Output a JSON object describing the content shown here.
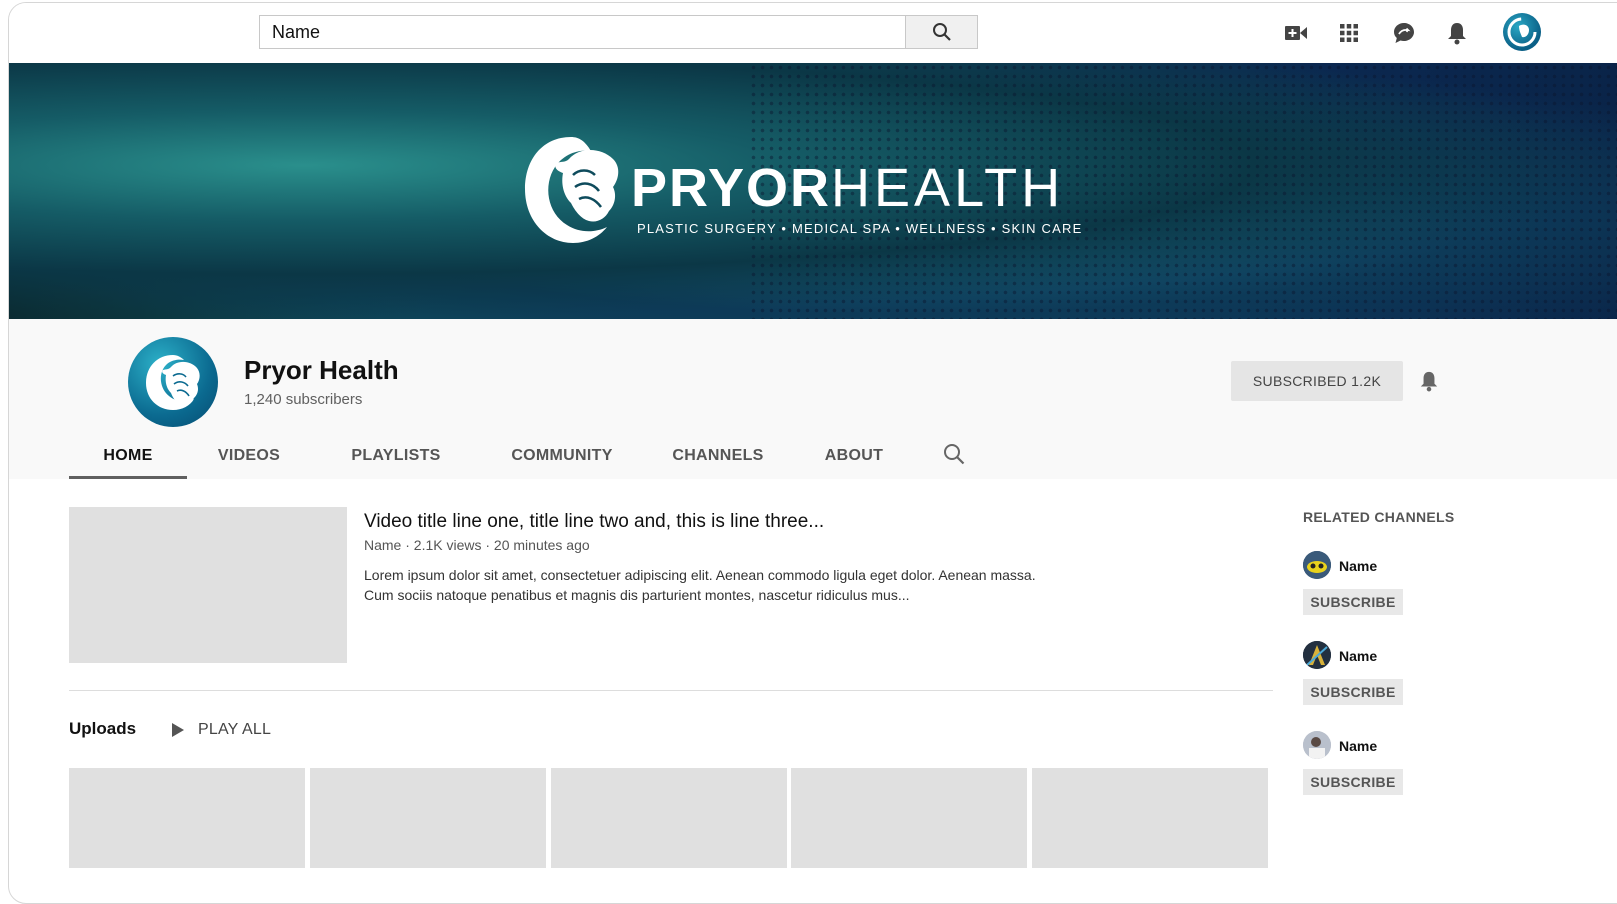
{
  "search": {
    "value": "Name"
  },
  "banner": {
    "brand_bold": "PRYOR",
    "brand_light": "HEALTH",
    "tagline": "PLASTIC SURGERY • MEDICAL SPA  • WELLNESS • SKIN CARE"
  },
  "channel": {
    "name": "Pryor Health",
    "subscribers": "1,240 subscribers",
    "subscribed_label": "SUBSCRIBED 1.2K"
  },
  "tabs": [
    {
      "label": "HOME",
      "active": true
    },
    {
      "label": "VIDEOS"
    },
    {
      "label": "PLAYLISTS"
    },
    {
      "label": "COMMUNITY"
    },
    {
      "label": "CHANNELS"
    },
    {
      "label": "ABOUT"
    }
  ],
  "featured": {
    "title": "Video title line one, title line two and, this is line three...",
    "meta": "Name · 2.1K views · 20 minutes ago",
    "description_line1": "Lorem ipsum dolor sit amet, consectetuer adipiscing elit. Aenean commodo ligula eget dolor. Aenean massa.",
    "description_line2": "Cum sociis natoque penatibus et magnis dis parturient montes, nascetur ridiculus mus..."
  },
  "uploads": {
    "label": "Uploads",
    "play_all": "PLAY ALL"
  },
  "related": {
    "title": "RELATED CHANNELS",
    "channels": [
      {
        "name": "Name",
        "subscribe": "SUBSCRIBE"
      },
      {
        "name": "Name",
        "subscribe": "SUBSCRIBE"
      },
      {
        "name": "Name",
        "subscribe": "SUBSCRIBE"
      }
    ]
  },
  "icons": [
    "search-icon",
    "create-video-icon",
    "apps-grid-icon",
    "messages-icon",
    "notifications-bell-icon",
    "account-avatar",
    "play-icon"
  ],
  "colors": {
    "brand_teal": "#0b6a90",
    "banner_dark": "#0b2c33"
  }
}
